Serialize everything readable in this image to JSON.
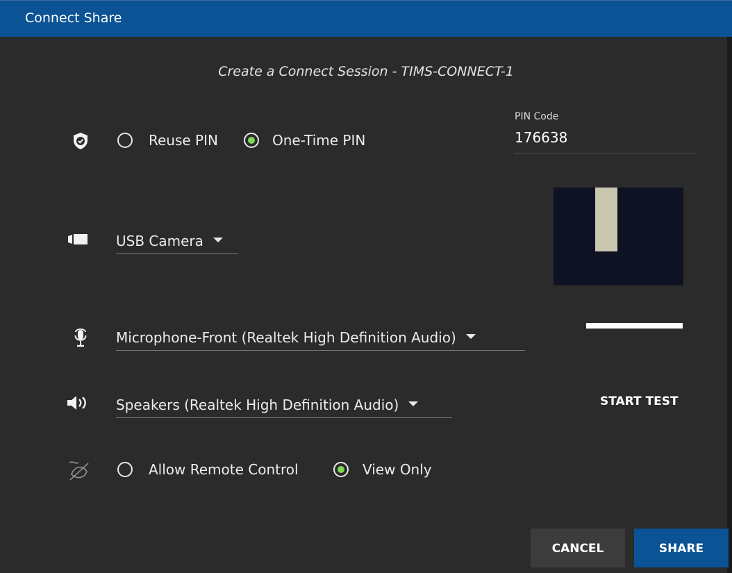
{
  "window": {
    "title": "Connect Share"
  },
  "dialog": {
    "subtitle": "Create a Connect Session - TIMS-CONNECT-1"
  },
  "pin": {
    "options": [
      {
        "label": "Reuse PIN",
        "checked": false
      },
      {
        "label": "One-Time PIN",
        "checked": true
      }
    ],
    "code_label": "PIN Code",
    "code_value": "176638"
  },
  "camera": {
    "selected": "USB Camera"
  },
  "microphone": {
    "selected": "Microphone-Front (Realtek High Definition Audio)"
  },
  "speakers": {
    "selected": "Speakers (Realtek High Definition Audio)",
    "test_label": "START TEST"
  },
  "remote_control": {
    "options": [
      {
        "label": "Allow Remote Control",
        "checked": false
      },
      {
        "label": "View Only",
        "checked": true
      }
    ]
  },
  "buttons": {
    "cancel": "CANCEL",
    "share": "SHARE"
  },
  "colors": {
    "accent": "#0b5394",
    "radio_selected": "#7ed957",
    "background": "#2b2b2b"
  },
  "icons": [
    "shield-check-icon",
    "camera-icon",
    "microphone-icon",
    "speaker-icon",
    "remote-control-disabled-icon",
    "chevron-down-icon"
  ]
}
